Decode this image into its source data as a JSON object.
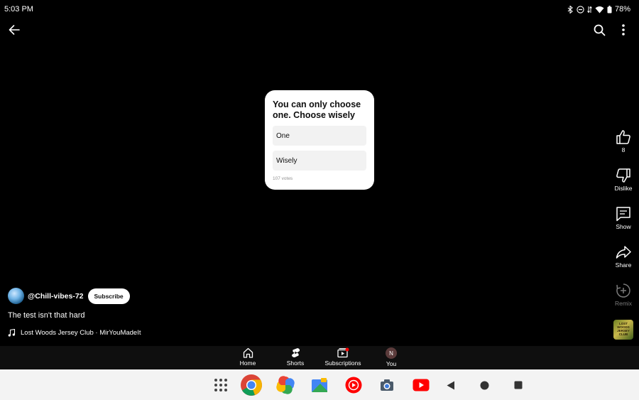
{
  "status_bar": {
    "time": "5:03 PM",
    "battery": "78%",
    "icons": [
      "bluetooth-icon",
      "dnd-icon",
      "data-icon",
      "wifi-icon",
      "battery-icon"
    ]
  },
  "top_bar": {
    "icons": [
      "back-arrow-icon",
      "search-icon",
      "more-vert-icon"
    ]
  },
  "poll": {
    "question": "You can only choose one. Choose wisely",
    "options": [
      "One",
      "Wisely"
    ],
    "votes": "107 votes"
  },
  "actions": {
    "like_count": "8",
    "dislike_label": "Dislike",
    "comments_label": "Show",
    "share_label": "Share",
    "remix_label": "Remix",
    "music_thumb_text": "LOST WOODS JERSEY CLUB"
  },
  "channel": {
    "handle": "@Chill-vibes-72",
    "subscribe_label": "Subscribe"
  },
  "video": {
    "title": "The test isn't that hard",
    "music": "Lost Woods Jersey Club · MirYouMadeIt"
  },
  "yt_nav": {
    "home": "Home",
    "shorts": "Shorts",
    "subscriptions": "Subscriptions",
    "you": "You",
    "avatar_letter": "N"
  },
  "system_nav": {
    "apps": [
      "app-drawer-icon",
      "chrome-icon",
      "photos-icon",
      "files-icon",
      "yt-music-icon",
      "camera-icon",
      "youtube-icon"
    ],
    "buttons": [
      "back-icon",
      "home-icon",
      "recents-icon"
    ]
  },
  "colors": {
    "background": "#000000",
    "card": "#ffffff",
    "option_bg": "#f2f2f2",
    "nav_bg": "#0f0f0f",
    "system_nav_bg": "#f3f3f3",
    "youtube_red": "#ff0000"
  }
}
